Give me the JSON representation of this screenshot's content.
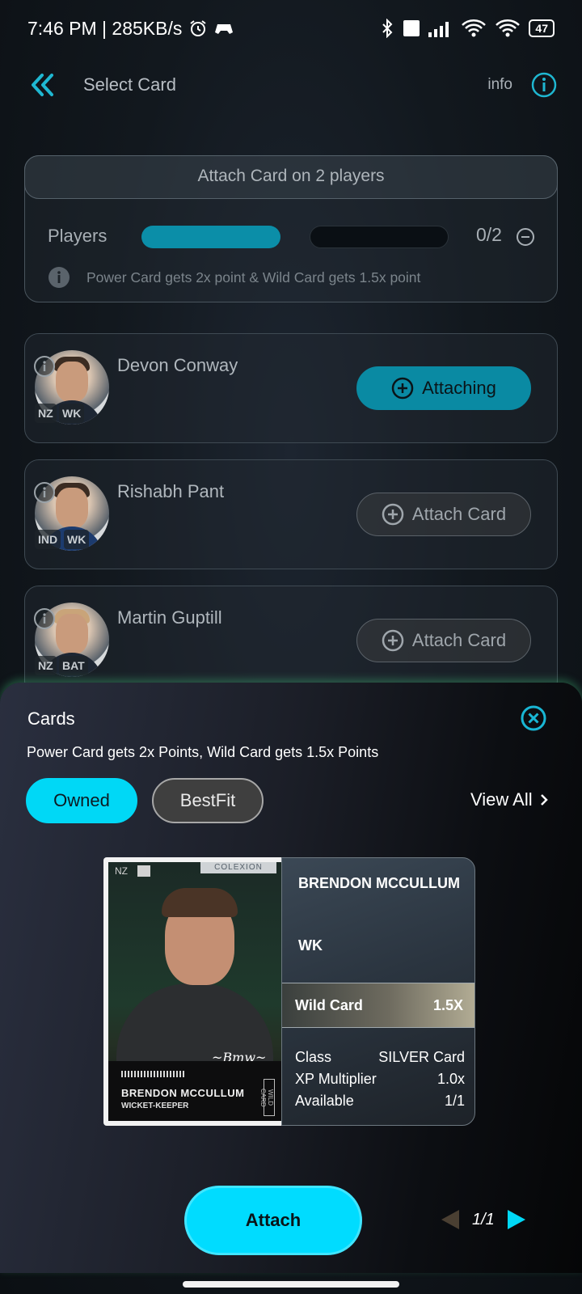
{
  "status_bar": {
    "time": "7:46 PM | 285KB/s",
    "battery": "47"
  },
  "header": {
    "title": "Select Card",
    "info_label": "info"
  },
  "attach_panel": {
    "heading": "Attach Card on 2 players",
    "players_label": "Players",
    "progress_count": "0/2",
    "progress_fraction": 0.0,
    "note": "Power Card gets 2x point & Wild Card gets 1.5x point"
  },
  "players": [
    {
      "name": "Devon Conway",
      "country": "NZ",
      "role": "WK",
      "button": "Attaching"
    },
    {
      "name": "Rishabh Pant",
      "country": "IND",
      "role": "WK",
      "button": "Attach Card"
    },
    {
      "name": "Martin Guptill",
      "country": "NZ",
      "role": "BAT",
      "button": "Attach Card"
    }
  ],
  "sheet": {
    "title": "Cards",
    "subtitle": "Power Card gets 2x Points, Wild Card gets 1.5x Points",
    "filters": [
      "Owned",
      "BestFit"
    ],
    "view_all": "View All",
    "card": {
      "flag": "NZ",
      "brand": "COLEXION",
      "print_name": "BRENDON MCCULLUM",
      "print_role": "WICKET-KEEPER",
      "print_tag": "WILD CARD",
      "name": "BRENDON MCCULLUM",
      "role": "WK",
      "type": "Wild Card",
      "multiplier": "1.5X",
      "stats": [
        {
          "label": "Class",
          "value": "SILVER Card"
        },
        {
          "label": "XP Multiplier",
          "value": "1.0x"
        },
        {
          "label": "Available",
          "value": "1/1"
        }
      ]
    },
    "attach_button": "Attach",
    "pager": "1/1"
  },
  "colors": {
    "accent": "#00dcff",
    "accent_dark": "#0a8aa3"
  }
}
